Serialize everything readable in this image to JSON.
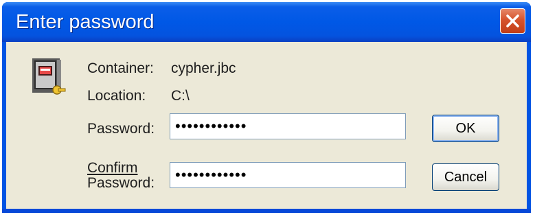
{
  "window": {
    "title": "Enter password"
  },
  "info": {
    "container_label": "Container:",
    "container_value": "cypher.jbc",
    "location_label": "Location:",
    "location_value": "C:\\"
  },
  "password": {
    "label": "Password:",
    "value": "••••••••••••"
  },
  "confirm": {
    "label_line1": "Confirm",
    "label_line2": "Password:",
    "value": "••••••••••••"
  },
  "buttons": {
    "ok": "OK",
    "cancel": "Cancel"
  },
  "icons": {
    "app": "safe-icon",
    "close": "close-icon"
  }
}
